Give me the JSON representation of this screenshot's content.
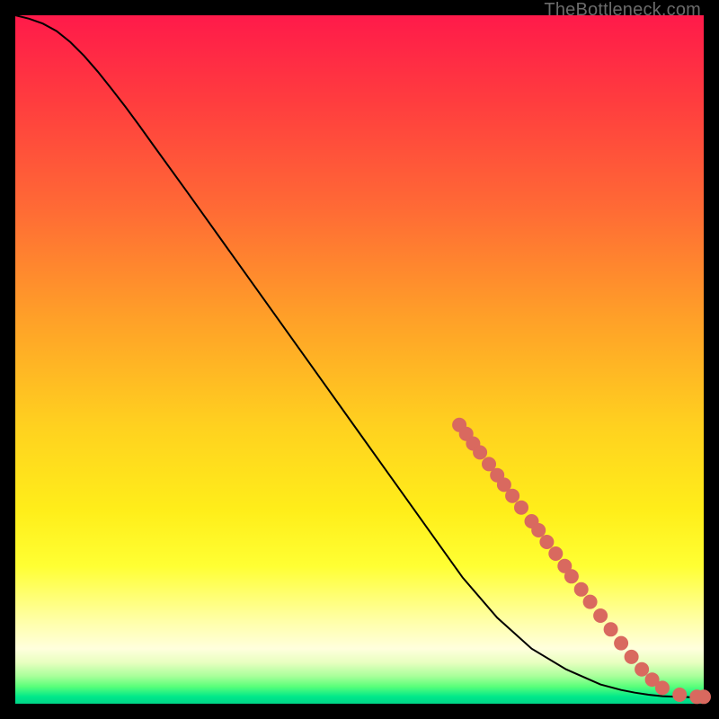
{
  "watermark": "TheBottleneck.com",
  "chart_data": {
    "type": "line",
    "title": "",
    "xlabel": "",
    "ylabel": "",
    "xlim": [
      0,
      100
    ],
    "ylim": [
      0,
      100
    ],
    "grid": false,
    "legend": false,
    "series": [
      {
        "name": "curve",
        "style": "line",
        "x": [
          0,
          2,
          4,
          6,
          8,
          10,
          12,
          14,
          16,
          18,
          20,
          25,
          30,
          35,
          40,
          45,
          50,
          55,
          60,
          65,
          70,
          75,
          80,
          85,
          88,
          90,
          92,
          94,
          96,
          98,
          99,
          100
        ],
        "y": [
          100,
          99.5,
          98.8,
          97.7,
          96.1,
          94.1,
          91.8,
          89.3,
          86.7,
          84.0,
          81.2,
          74.3,
          67.3,
          60.3,
          53.3,
          46.3,
          39.3,
          32.3,
          25.3,
          18.3,
          12.5,
          8.0,
          5.0,
          2.8,
          2.0,
          1.6,
          1.3,
          1.1,
          1.0,
          0.95,
          0.93,
          0.92
        ]
      },
      {
        "name": "markers",
        "style": "scatter",
        "points": [
          {
            "x": 64.5,
            "y": 40.5
          },
          {
            "x": 65.5,
            "y": 39.2
          },
          {
            "x": 66.5,
            "y": 37.8
          },
          {
            "x": 67.5,
            "y": 36.5
          },
          {
            "x": 68.8,
            "y": 34.8
          },
          {
            "x": 70.0,
            "y": 33.2
          },
          {
            "x": 71.0,
            "y": 31.8
          },
          {
            "x": 72.2,
            "y": 30.2
          },
          {
            "x": 73.5,
            "y": 28.5
          },
          {
            "x": 75.0,
            "y": 26.5
          },
          {
            "x": 76.0,
            "y": 25.2
          },
          {
            "x": 77.2,
            "y": 23.5
          },
          {
            "x": 78.5,
            "y": 21.8
          },
          {
            "x": 79.8,
            "y": 20.0
          },
          {
            "x": 80.8,
            "y": 18.5
          },
          {
            "x": 82.2,
            "y": 16.6
          },
          {
            "x": 83.5,
            "y": 14.8
          },
          {
            "x": 85.0,
            "y": 12.8
          },
          {
            "x": 86.5,
            "y": 10.8
          },
          {
            "x": 88.0,
            "y": 8.8
          },
          {
            "x": 89.5,
            "y": 6.8
          },
          {
            "x": 91.0,
            "y": 5.0
          },
          {
            "x": 92.5,
            "y": 3.5
          },
          {
            "x": 94.0,
            "y": 2.3
          },
          {
            "x": 96.5,
            "y": 1.3
          },
          {
            "x": 99.0,
            "y": 1.0
          },
          {
            "x": 100.0,
            "y": 1.0
          }
        ]
      }
    ]
  },
  "colors": {
    "marker": "#d9695f",
    "curve": "#000000"
  }
}
